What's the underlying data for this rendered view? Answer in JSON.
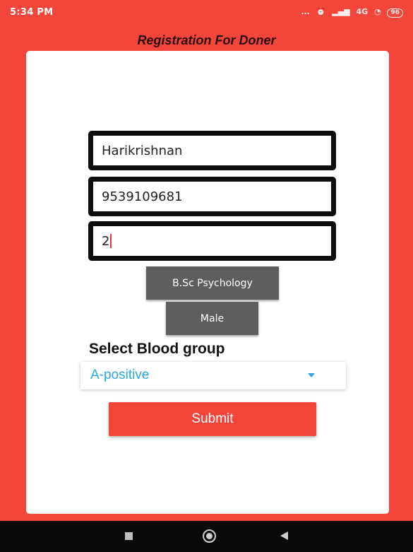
{
  "status_bar": {
    "time": "5:34 PM",
    "dots": "...",
    "network": "4G",
    "battery": "96"
  },
  "app": {
    "title": "Registration For Doner"
  },
  "form": {
    "name_value": "Harikrishnan",
    "phone_value": "9539109681",
    "age_value": "2",
    "course_button": "B.Sc Psychology",
    "gender_button": "Male",
    "blood_group_label": "Select Blood group",
    "blood_group_selected": "A-positive",
    "submit_label": "Submit"
  },
  "colors": {
    "primary": "#f2463a",
    "button_gray": "#5e5e5e",
    "dropdown_text": "#29a8e0"
  },
  "icons": {
    "dropdown": "chevron-down-icon",
    "nav_recents": "recents-icon",
    "nav_home": "home-icon",
    "nav_back": "back-icon"
  }
}
